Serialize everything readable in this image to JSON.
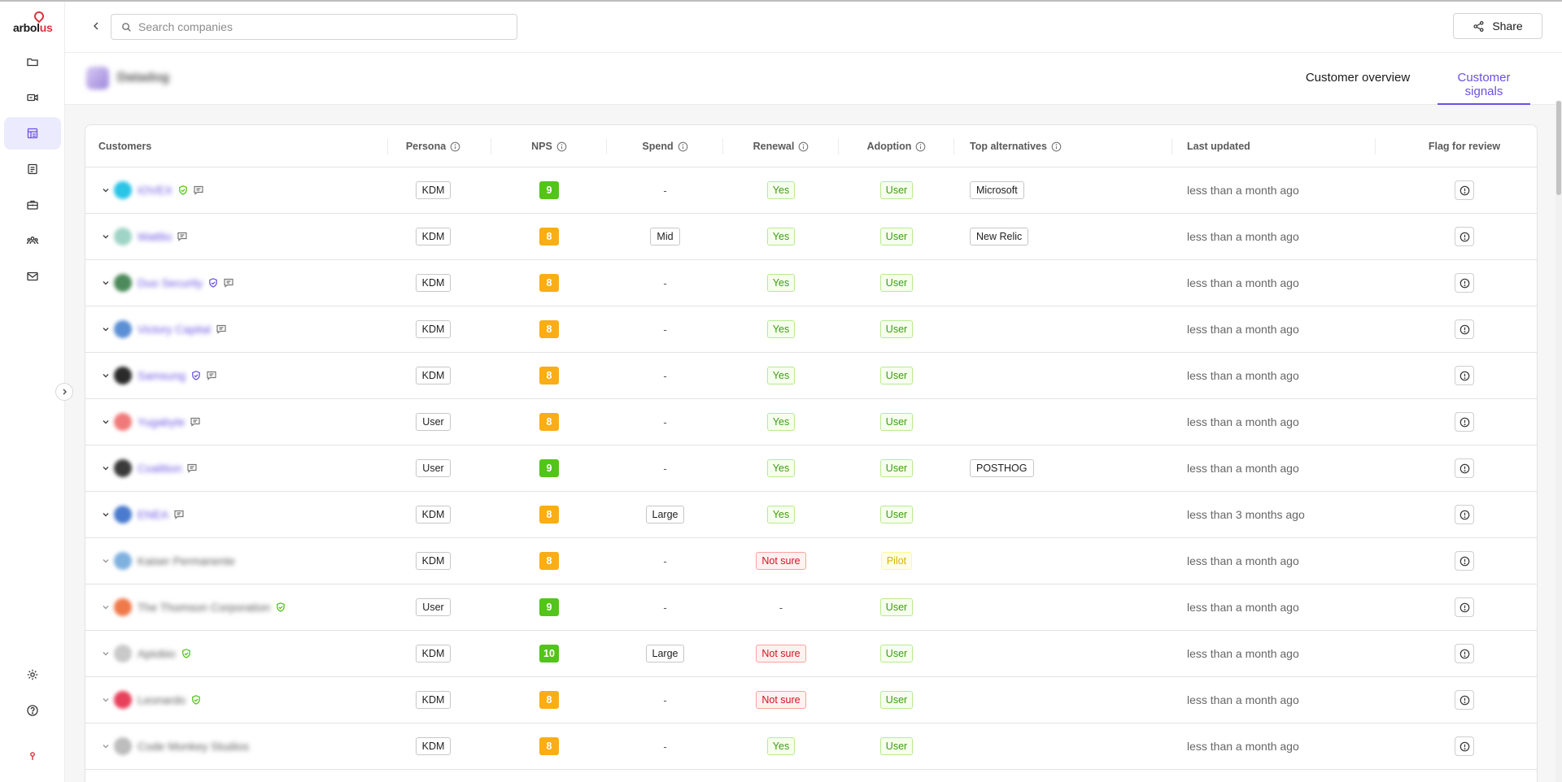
{
  "app": {
    "logo_text_dark": "arbol",
    "logo_text_red": "us"
  },
  "sidebar": {
    "items": [
      {
        "icon": "folder-icon",
        "active": false
      },
      {
        "icon": "video-icon",
        "active": false
      },
      {
        "icon": "dashboard-icon",
        "active": true
      },
      {
        "icon": "clipboard-icon",
        "active": false
      },
      {
        "icon": "briefcase-icon",
        "active": false
      },
      {
        "icon": "people-icon",
        "active": false
      },
      {
        "icon": "mail-icon",
        "active": false
      }
    ],
    "bottom_items": [
      {
        "icon": "gear-icon"
      },
      {
        "icon": "help-icon"
      },
      {
        "icon": "pin-icon"
      }
    ]
  },
  "topbar": {
    "search_placeholder": "Search companies",
    "share_label": "Share"
  },
  "company": {
    "name": "Datadog"
  },
  "tabs": [
    {
      "label": "Customer overview",
      "active": false
    },
    {
      "label": "Customer signals",
      "active": true
    }
  ],
  "table": {
    "headers": {
      "customers": "Customers",
      "persona": "Persona",
      "nps": "NPS",
      "spend": "Spend",
      "renewal": "Renewal",
      "adoption": "Adoption",
      "top_alternatives": "Top alternatives",
      "last_updated": "Last updated",
      "flag_for_review": "Flag for review"
    },
    "rows": [
      {
        "name": "IOVEX",
        "link": true,
        "avatar_color": "#29c4e6",
        "verified": "green",
        "comment": true,
        "persona": "KDM",
        "nps": "9",
        "nps_color": "green",
        "spend": "-",
        "renewal": "Yes",
        "adoption": "User",
        "alternative": "Microsoft",
        "updated": "less than a month ago"
      },
      {
        "name": "Wattlio",
        "link": true,
        "avatar_color": "#9fd4c6",
        "verified": "",
        "comment": true,
        "persona": "KDM",
        "nps": "8",
        "nps_color": "amber",
        "spend": "Mid",
        "renewal": "Yes",
        "adoption": "User",
        "alternative": "New Relic",
        "updated": "less than a month ago"
      },
      {
        "name": "Duo Security",
        "link": true,
        "avatar_color": "#4c8a5b",
        "verified": "purple",
        "comment": true,
        "persona": "KDM",
        "nps": "8",
        "nps_color": "amber",
        "spend": "-",
        "renewal": "Yes",
        "adoption": "User",
        "alternative": "",
        "updated": "less than a month ago"
      },
      {
        "name": "Victory Capital",
        "link": true,
        "avatar_color": "#5b8fd6",
        "verified": "",
        "comment": true,
        "persona": "KDM",
        "nps": "8",
        "nps_color": "amber",
        "spend": "-",
        "renewal": "Yes",
        "adoption": "User",
        "alternative": "",
        "updated": "less than a month ago"
      },
      {
        "name": "Samsung",
        "link": true,
        "avatar_color": "#2a2a2a",
        "verified": "purple",
        "comment": true,
        "persona": "KDM",
        "nps": "8",
        "nps_color": "amber",
        "spend": "-",
        "renewal": "Yes",
        "adoption": "User",
        "alternative": "",
        "updated": "less than a month ago"
      },
      {
        "name": "Yugabyte",
        "link": true,
        "avatar_color": "#f07a7a",
        "verified": "",
        "comment": true,
        "persona": "User",
        "nps": "8",
        "nps_color": "amber",
        "spend": "-",
        "renewal": "Yes",
        "adoption": "User",
        "alternative": "",
        "updated": "less than a month ago"
      },
      {
        "name": "Coalition",
        "link": true,
        "avatar_color": "#3a3a3a",
        "verified": "",
        "comment": true,
        "persona": "User",
        "nps": "9",
        "nps_color": "green",
        "spend": "-",
        "renewal": "Yes",
        "adoption": "User",
        "alternative": "POSTHOG",
        "updated": "less than a month ago"
      },
      {
        "name": "ENEA",
        "link": true,
        "avatar_color": "#4a7bcf",
        "verified": "",
        "comment": true,
        "persona": "KDM",
        "nps": "8",
        "nps_color": "amber",
        "spend": "Large",
        "renewal": "Yes",
        "adoption": "User",
        "alternative": "",
        "updated": "less than 3 months ago"
      },
      {
        "name": "Kaiser Permanente",
        "link": false,
        "avatar_color": "#7fb1df",
        "verified": "",
        "comment": false,
        "persona": "KDM",
        "nps": "8",
        "nps_color": "amber",
        "spend": "-",
        "renewal": "Not sure",
        "renewal_type": "red",
        "adoption": "Pilot",
        "adoption_type": "yellow",
        "alternative": "",
        "updated": "less than a month ago"
      },
      {
        "name": "The Thomson Corporation",
        "link": false,
        "avatar_color": "#f0794a",
        "verified": "green",
        "comment": false,
        "persona": "User",
        "nps": "9",
        "nps_color": "green",
        "spend": "-",
        "renewal": "-",
        "renewal_type": "dash",
        "adoption": "User",
        "alternative": "",
        "updated": "less than a month ago"
      },
      {
        "name": "Apiobio",
        "link": false,
        "avatar_color": "#c9c9c9",
        "verified": "green",
        "comment": false,
        "persona": "KDM",
        "nps": "10",
        "nps_color": "green",
        "spend": "Large",
        "renewal": "Not sure",
        "renewal_type": "red",
        "adoption": "User",
        "alternative": "",
        "updated": "less than a month ago"
      },
      {
        "name": "Leonardo",
        "link": false,
        "avatar_color": "#e8415c",
        "verified": "green",
        "comment": false,
        "persona": "KDM",
        "nps": "8",
        "nps_color": "amber",
        "spend": "-",
        "renewal": "Not sure",
        "renewal_type": "red",
        "adoption": "User",
        "alternative": "",
        "updated": "less than a month ago"
      },
      {
        "name": "Code Monkey Studios",
        "link": false,
        "avatar_color": "#bdbdbd",
        "verified": "",
        "comment": false,
        "persona": "KDM",
        "nps": "8",
        "nps_color": "amber",
        "spend": "-",
        "renewal": "Yes",
        "adoption": "User",
        "alternative": "",
        "updated": "less than a month ago"
      }
    ]
  }
}
